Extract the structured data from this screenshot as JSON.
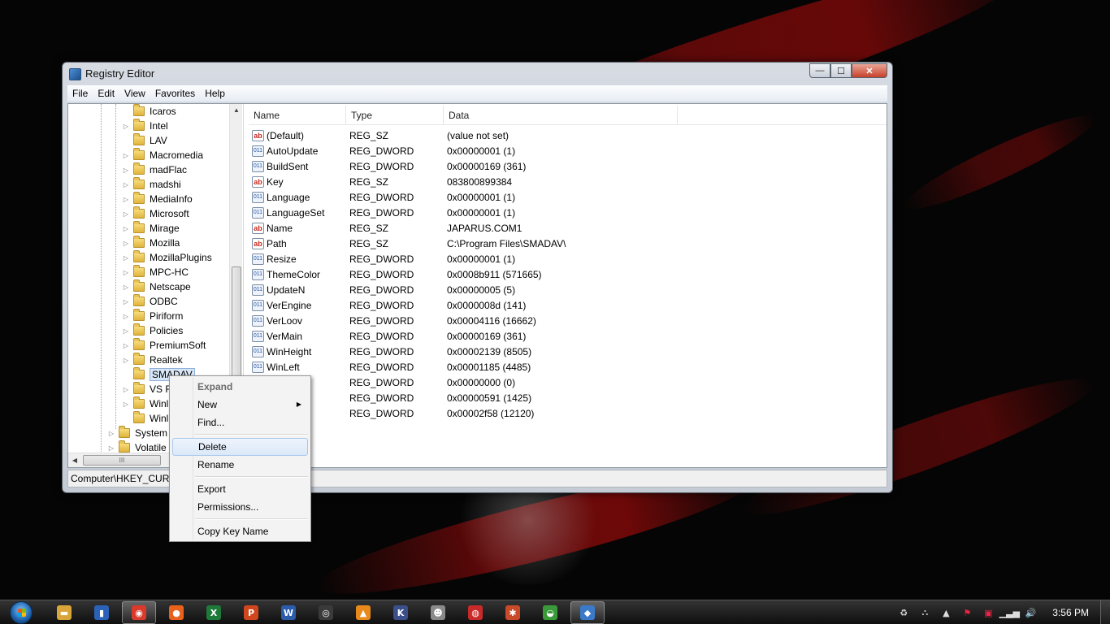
{
  "window": {
    "title": "Registry Editor",
    "buttons": {
      "minimize": "—",
      "maximize": "☐",
      "close": "✕"
    }
  },
  "menu": [
    "File",
    "Edit",
    "View",
    "Favorites",
    "Help"
  ],
  "tree": {
    "items": [
      {
        "label": "Icaros",
        "expandable": false
      },
      {
        "label": "Intel",
        "expandable": true
      },
      {
        "label": "LAV",
        "expandable": false
      },
      {
        "label": "Macromedia",
        "expandable": true
      },
      {
        "label": "madFlac",
        "expandable": true
      },
      {
        "label": "madshi",
        "expandable": true
      },
      {
        "label": "MediaInfo",
        "expandable": true
      },
      {
        "label": "Microsoft",
        "expandable": true
      },
      {
        "label": "Mirage",
        "expandable": true
      },
      {
        "label": "Mozilla",
        "expandable": true
      },
      {
        "label": "MozillaPlugins",
        "expandable": true
      },
      {
        "label": "MPC-HC",
        "expandable": true
      },
      {
        "label": "Netscape",
        "expandable": true
      },
      {
        "label": "ODBC",
        "expandable": true
      },
      {
        "label": "Piriform",
        "expandable": true
      },
      {
        "label": "Policies",
        "expandable": true
      },
      {
        "label": "PremiumSoft",
        "expandable": true
      },
      {
        "label": "Realtek",
        "expandable": true
      },
      {
        "label": "SMADAV",
        "expandable": false,
        "selected": true
      },
      {
        "label": "VS R",
        "expandable": true
      },
      {
        "label": "Winl",
        "expandable": true
      },
      {
        "label": "Winl",
        "expandable": false
      }
    ],
    "parent_items": [
      {
        "label": "System",
        "expandable": true
      },
      {
        "label": "Volatile",
        "expandable": true
      }
    ],
    "hscroll_grip": "III"
  },
  "columns": [
    "Name",
    "Type",
    "Data"
  ],
  "values": [
    {
      "name": "(Default)",
      "type": "REG_SZ",
      "data": "(value not set)",
      "kind": "sz"
    },
    {
      "name": "AutoUpdate",
      "type": "REG_DWORD",
      "data": "0x00000001 (1)",
      "kind": "dw"
    },
    {
      "name": "BuildSent",
      "type": "REG_DWORD",
      "data": "0x00000169 (361)",
      "kind": "dw"
    },
    {
      "name": "Key",
      "type": "REG_SZ",
      "data": "083800899384",
      "kind": "sz"
    },
    {
      "name": "Language",
      "type": "REG_DWORD",
      "data": "0x00000001 (1)",
      "kind": "dw"
    },
    {
      "name": "LanguageSet",
      "type": "REG_DWORD",
      "data": "0x00000001 (1)",
      "kind": "dw"
    },
    {
      "name": "Name",
      "type": "REG_SZ",
      "data": "JAPARUS.COM1",
      "kind": "sz"
    },
    {
      "name": "Path",
      "type": "REG_SZ",
      "data": "C:\\Program Files\\SMADAV\\",
      "kind": "sz"
    },
    {
      "name": "Resize",
      "type": "REG_DWORD",
      "data": "0x00000001 (1)",
      "kind": "dw"
    },
    {
      "name": "ThemeColor",
      "type": "REG_DWORD",
      "data": "0x0008b911 (571665)",
      "kind": "dw"
    },
    {
      "name": "UpdateN",
      "type": "REG_DWORD",
      "data": "0x00000005 (5)",
      "kind": "dw"
    },
    {
      "name": "VerEngine",
      "type": "REG_DWORD",
      "data": "0x0000008d (141)",
      "kind": "dw"
    },
    {
      "name": "VerLoov",
      "type": "REG_DWORD",
      "data": "0x00004116 (16662)",
      "kind": "dw"
    },
    {
      "name": "VerMain",
      "type": "REG_DWORD",
      "data": "0x00000169 (361)",
      "kind": "dw"
    },
    {
      "name": "WinHeight",
      "type": "REG_DWORD",
      "data": "0x00002139 (8505)",
      "kind": "dw"
    },
    {
      "name": "WinLeft",
      "type": "REG_DWORD",
      "data": "0x00001185 (4485)",
      "kind": "dw"
    },
    {
      "name": "",
      "type": "REG_DWORD",
      "data": "0x00000000 (0)",
      "kind": "dw"
    },
    {
      "name": "",
      "type": "REG_DWORD",
      "data": "0x00000591 (1425)",
      "kind": "dw"
    },
    {
      "name": "",
      "type": "REG_DWORD",
      "data": "0x00002f58 (12120)",
      "kind": "dw"
    }
  ],
  "value_icons": {
    "sz": "ab",
    "dw": "011"
  },
  "statusbar": {
    "path": "Computer\\HKEY_CURR"
  },
  "context_menu": {
    "items": [
      {
        "label": "Expand",
        "disabled": true
      },
      {
        "label": "New",
        "submenu": true
      },
      {
        "label": "Find..."
      },
      {
        "separator": true
      },
      {
        "label": "Delete",
        "highlighted": true
      },
      {
        "label": "Rename"
      },
      {
        "separator": true
      },
      {
        "label": "Export"
      },
      {
        "label": "Permissions..."
      },
      {
        "separator": true
      },
      {
        "label": "Copy Key Name"
      }
    ]
  },
  "taskbar": {
    "apps": [
      {
        "icon": "explorer-icon",
        "glyph": "▬",
        "color": "#d9a53a"
      },
      {
        "icon": "audio-app-icon",
        "glyph": "▮",
        "color": "#2b62b8"
      },
      {
        "icon": "chrome-icon",
        "glyph": "◉",
        "color": "#d93a2b",
        "active": true
      },
      {
        "icon": "firefox-icon",
        "glyph": "●",
        "color": "#e8621c"
      },
      {
        "icon": "excel-icon",
        "glyph": "X",
        "color": "#1f7a3a"
      },
      {
        "icon": "powerpoint-icon",
        "glyph": "P",
        "color": "#d0461d"
      },
      {
        "icon": "word-icon",
        "glyph": "W",
        "color": "#2a5caa"
      },
      {
        "icon": "camera-app-icon",
        "glyph": "◎",
        "color": "#3a3a3a"
      },
      {
        "icon": "vlc-icon",
        "glyph": "▲",
        "color": "#e8891c"
      },
      {
        "icon": "media-app-icon",
        "glyph": "K",
        "color": "#3b4f8a"
      },
      {
        "icon": "game-app-icon",
        "glyph": "☻",
        "color": "#8a8a8a"
      },
      {
        "icon": "antivirus-icon",
        "glyph": "◍",
        "color": "#c82a2a"
      },
      {
        "icon": "tool-app-icon",
        "glyph": "✱",
        "color": "#c74a2a"
      },
      {
        "icon": "chat-app-icon",
        "glyph": "◒",
        "color": "#3a9a3a"
      },
      {
        "icon": "registry-editor-icon",
        "glyph": "◆",
        "color": "#3b7ac8",
        "active": true
      }
    ],
    "clock": "3:56 PM"
  }
}
